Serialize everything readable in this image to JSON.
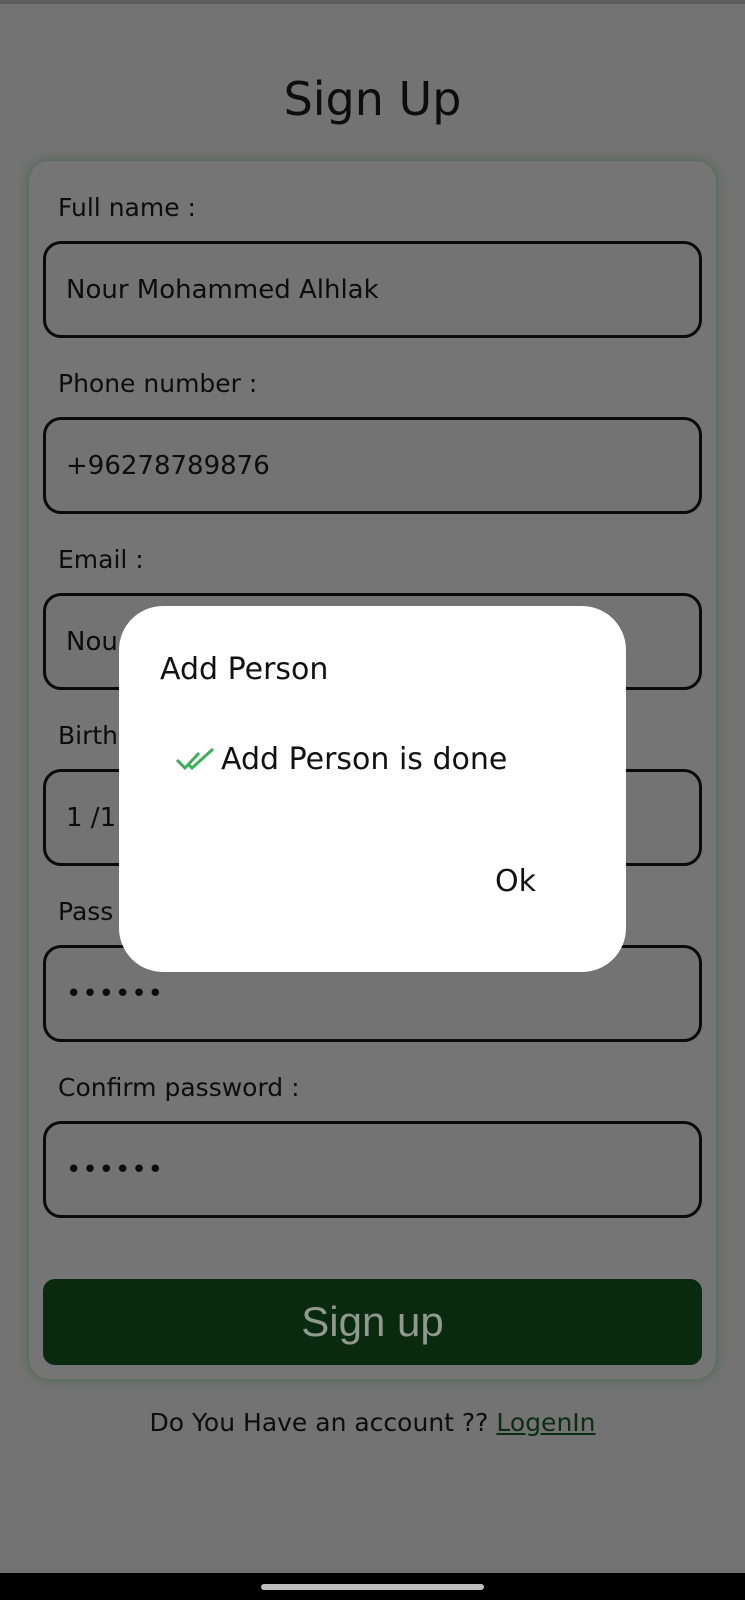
{
  "page": {
    "title": "Sign Up"
  },
  "form": {
    "full_name": {
      "label": "Full name :",
      "value": "Nour Mohammed Alhlak"
    },
    "phone": {
      "label": "Phone number :",
      "value": "+96278789876"
    },
    "email": {
      "label": "Email :",
      "value": "Nou"
    },
    "birth": {
      "label": "Birth",
      "value": "1 /1"
    },
    "password": {
      "label": "Pass",
      "value": "••••••"
    },
    "confirm_password": {
      "label": "Confirm password :",
      "value": "••••••"
    },
    "submit_label": "Sign up"
  },
  "footer": {
    "text": "Do You Have an account ?? ",
    "link": "LogenIn"
  },
  "dialog": {
    "title": "Add Person",
    "message": "Add Person is done",
    "ok_label": "Ok",
    "icon": "double-check-icon"
  },
  "colors": {
    "overlay": "#737373",
    "button_bg": "#0a2a10",
    "check": "#3fae5a"
  }
}
